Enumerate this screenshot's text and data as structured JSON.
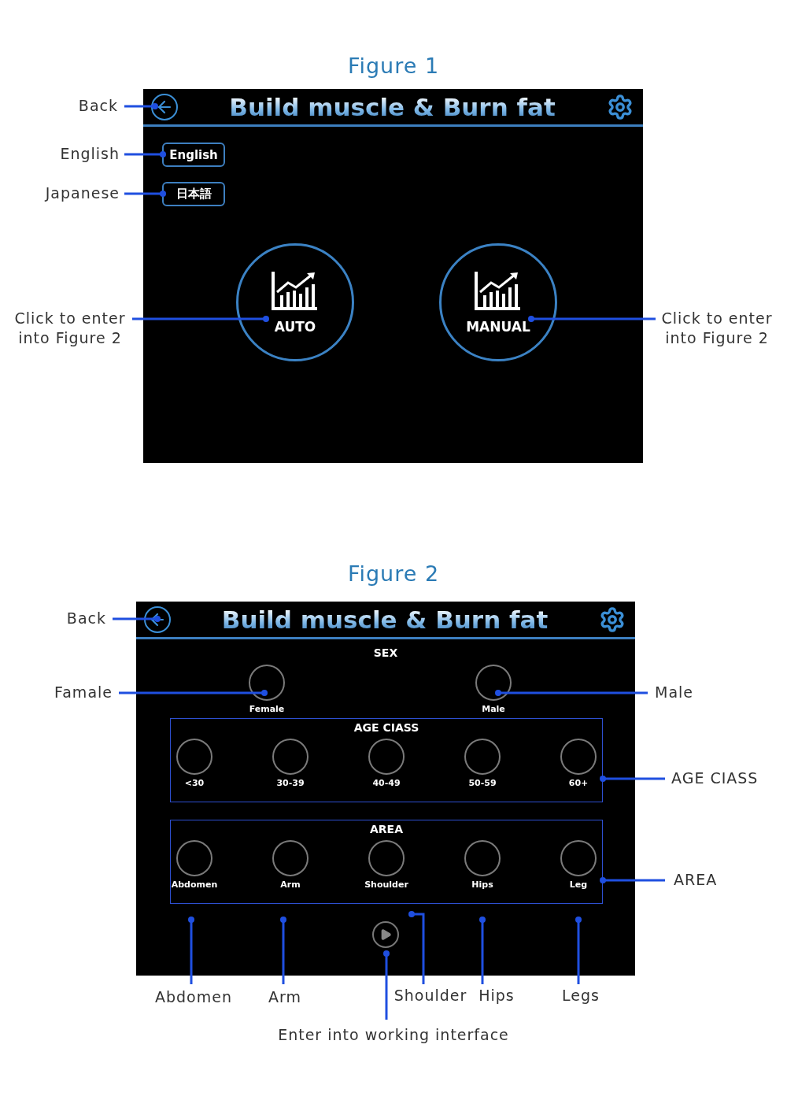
{
  "figures": [
    {
      "title": "Figure 1",
      "screen": {
        "kind": "mode-select",
        "title": "Build muscle & Burn fat",
        "languages": [
          {
            "label": "English"
          },
          {
            "label": "日本語"
          }
        ],
        "modes": [
          {
            "label": "AUTO"
          },
          {
            "label": "MANUAL"
          }
        ]
      },
      "callouts": [
        {
          "text": "Back"
        },
        {
          "text": "English"
        },
        {
          "text": "Japanese"
        },
        {
          "text": "Click to enter into Figure 2"
        },
        {
          "text": "Click to enter into Figure 2"
        }
      ]
    },
    {
      "title": "Figure 2",
      "screen": {
        "kind": "settings",
        "title": "Build muscle & Burn fat",
        "sex": {
          "title": "SEX",
          "options": [
            {
              "label": "Female",
              "selected": false
            },
            {
              "label": "Male",
              "selected": false
            }
          ]
        },
        "age_class": {
          "title": "AGE CIASS",
          "options": [
            {
              "label": "<30",
              "selected": false
            },
            {
              "label": "30-39",
              "selected": false
            },
            {
              "label": "40-49",
              "selected": false
            },
            {
              "label": "50-59",
              "selected": false
            },
            {
              "label": "60+",
              "selected": false
            }
          ]
        },
        "area": {
          "title": "AREA",
          "options": [
            {
              "label": "Abdomen",
              "selected": false
            },
            {
              "label": "Arm",
              "selected": false
            },
            {
              "label": "Shoulder",
              "selected": false
            },
            {
              "label": "Hips",
              "selected": false
            },
            {
              "label": "Leg",
              "selected": false
            }
          ]
        }
      },
      "callouts": [
        {
          "text": "Back"
        },
        {
          "text": "Famale"
        },
        {
          "text": "Male"
        },
        {
          "text": "AGE CIASS"
        },
        {
          "text": "AREA"
        },
        {
          "text": "Abdomen"
        },
        {
          "text": "Arm"
        },
        {
          "text": "Shoulder"
        },
        {
          "text": "Hips"
        },
        {
          "text": "Legs"
        },
        {
          "text": "Enter into working interface"
        }
      ]
    }
  ]
}
